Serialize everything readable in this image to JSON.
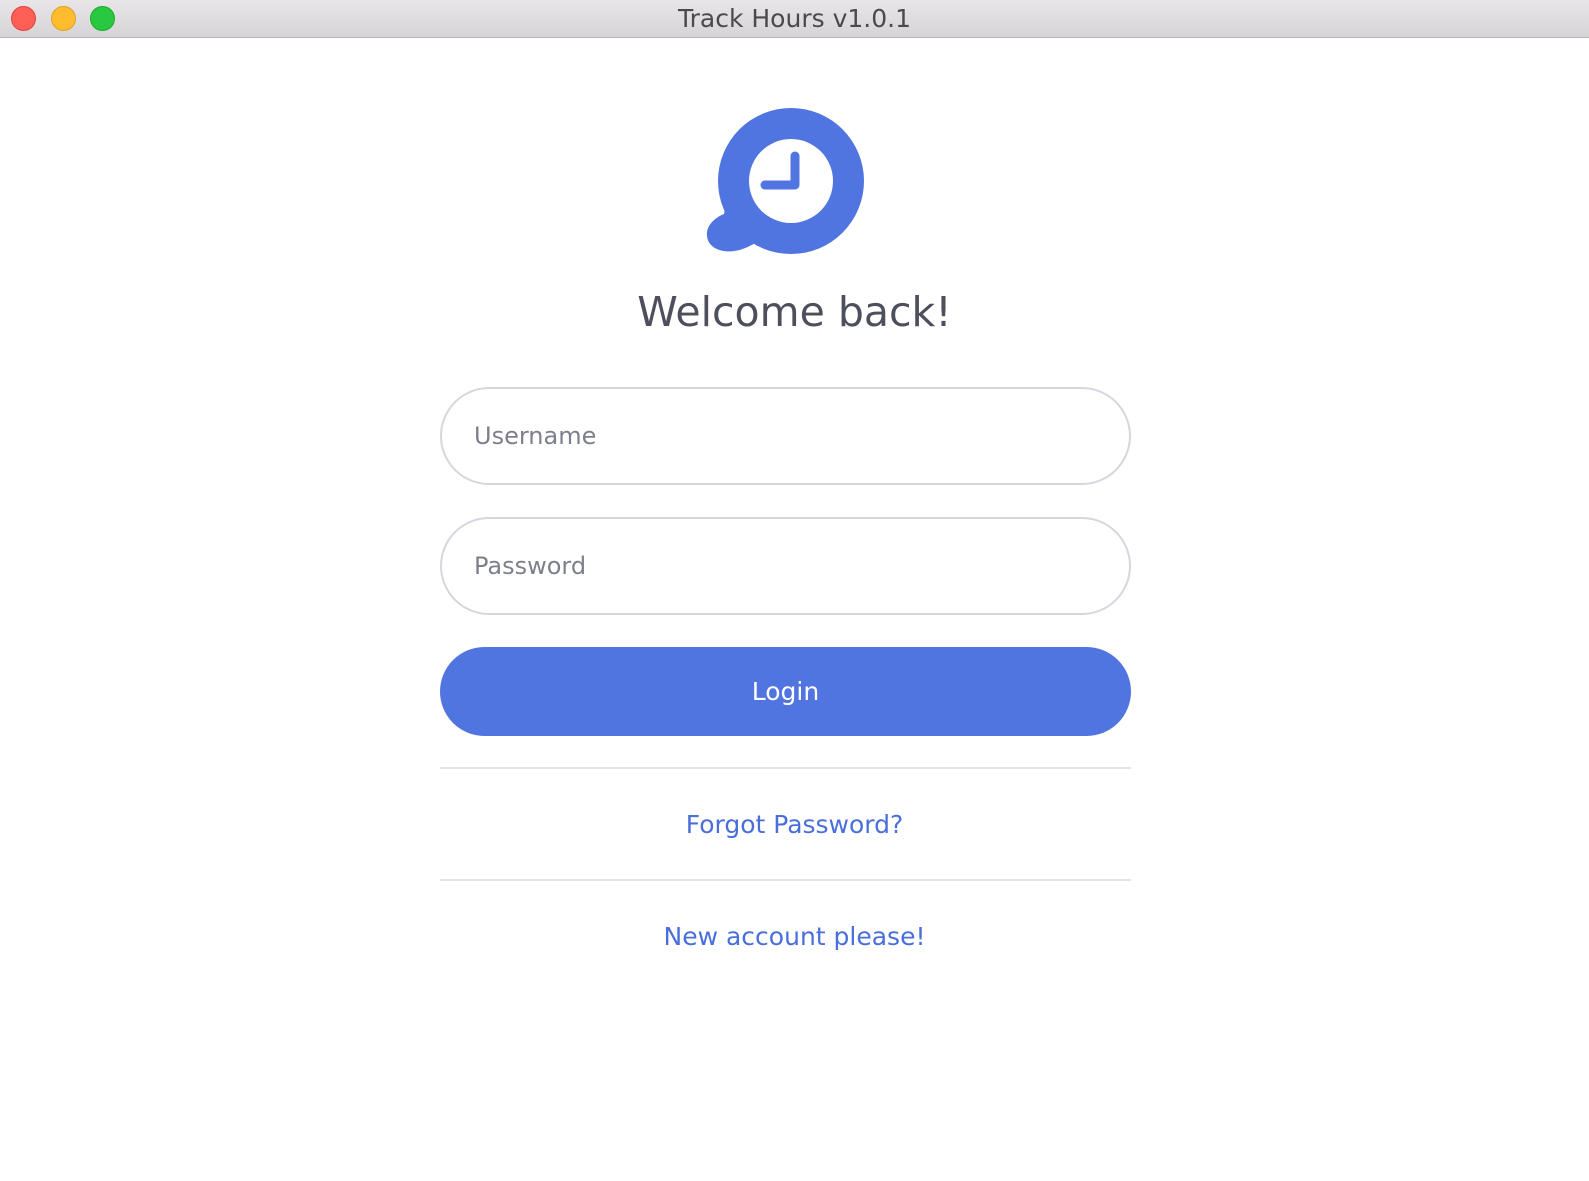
{
  "window": {
    "title": "Track Hours v1.0.1"
  },
  "logo": {
    "icon": "clock-chat-bubble-icon",
    "color": "#5074e0"
  },
  "login_form": {
    "heading": "Welcome back!",
    "username_placeholder": "Username",
    "password_placeholder": "Password",
    "login_label": "Login",
    "forgot_password_label": "Forgot Password?",
    "new_account_label": "New account please!"
  },
  "colors": {
    "accent": "#5074e0",
    "link": "#4a6fdc",
    "heading_text": "#4d4f5c",
    "field_border": "#d6d6e0"
  }
}
